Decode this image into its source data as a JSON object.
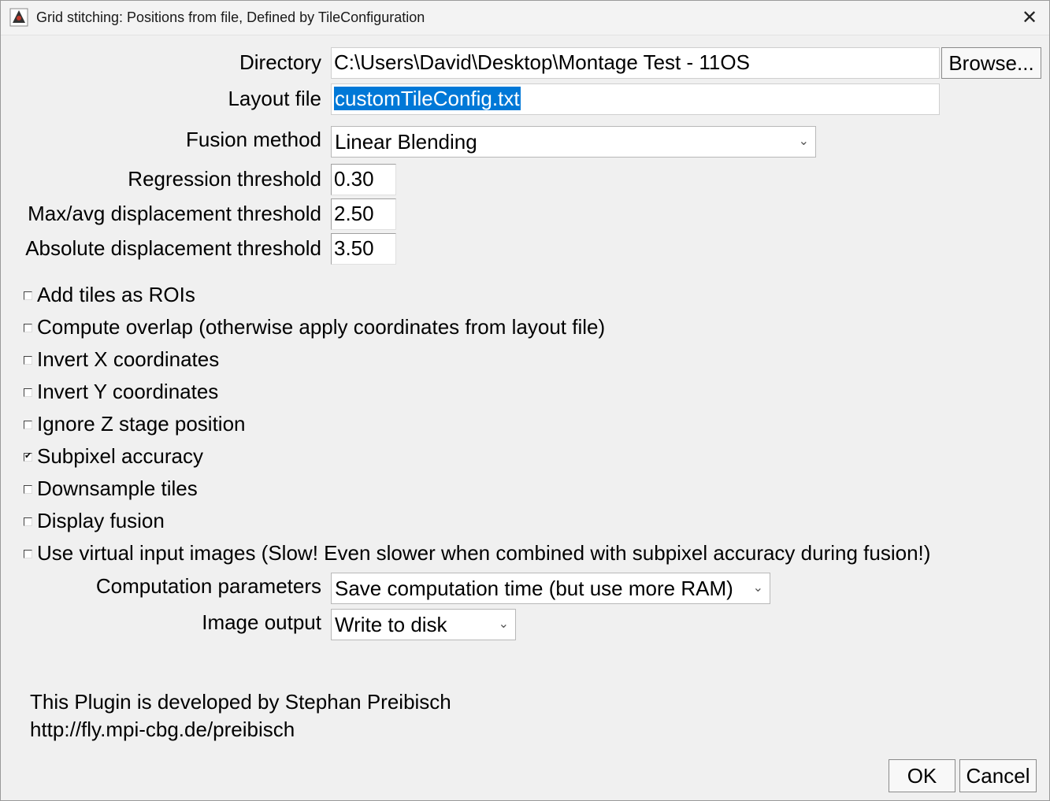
{
  "window": {
    "title": "Grid stitching: Positions from file, Defined by TileConfiguration",
    "close_glyph": "✕",
    "icon": "imagej-app-icon"
  },
  "form": {
    "directory": {
      "label": "Directory",
      "value": "C:\\Users\\David\\Desktop\\Montage Test - 11OS",
      "browse_label": "Browse..."
    },
    "layout_file": {
      "label": "Layout file",
      "value": "customTileConfig.txt"
    },
    "fusion_method": {
      "label": "Fusion method",
      "value": "Linear Blending"
    },
    "regression_threshold": {
      "label": "Regression threshold",
      "value": "0.30"
    },
    "max_avg_displacement": {
      "label": "Max/avg displacement threshold",
      "value": "2.50"
    },
    "absolute_displacement": {
      "label": "Absolute displacement threshold",
      "value": "3.50"
    },
    "computation_parameters": {
      "label": "Computation parameters",
      "value": "Save computation time (but use more RAM)"
    },
    "image_output": {
      "label": "Image output",
      "value": "Write to disk"
    }
  },
  "checkboxes": [
    {
      "label": "Add tiles as ROIs",
      "checked": false
    },
    {
      "label": "Compute overlap (otherwise apply coordinates from layout file)",
      "checked": false
    },
    {
      "label": "Invert X coordinates",
      "checked": false
    },
    {
      "label": "Invert Y coordinates",
      "checked": false
    },
    {
      "label": "Ignore Z stage position",
      "checked": false
    },
    {
      "label": "Subpixel accuracy",
      "checked": true
    },
    {
      "label": "Downsample tiles",
      "checked": false
    },
    {
      "label": "Display fusion",
      "checked": false
    },
    {
      "label": "Use virtual input images (Slow! Even slower when combined with subpixel accuracy during fusion!)",
      "checked": false
    }
  ],
  "footer": {
    "line1": "This Plugin is developed by Stephan Preibisch",
    "line2": "http://fly.mpi-cbg.de/preibisch"
  },
  "buttons": {
    "ok": "OK",
    "cancel": "Cancel"
  },
  "colors": {
    "selection": "#0078d7",
    "background": "#f0f0f0"
  }
}
